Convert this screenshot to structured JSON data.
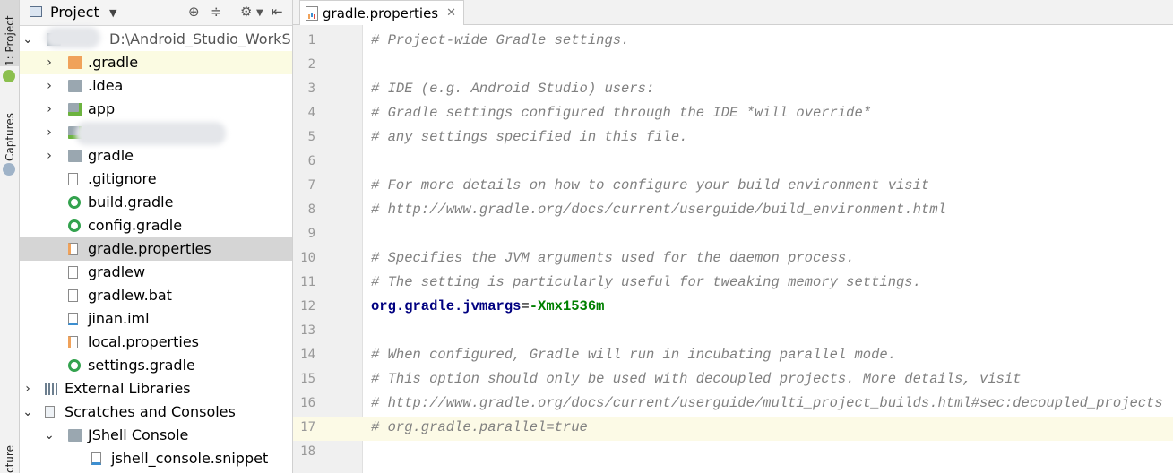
{
  "left_strip": {
    "project_tab": "1: Project",
    "captures_tab": "Captures",
    "structure_tab": "cture"
  },
  "project_panel": {
    "title": "Project",
    "root_path": "D:\\Android_Studio_WorkSp",
    "items": [
      {
        "label": ".gradle",
        "type": "folder-orange",
        "depth": 1,
        "arrow": "›"
      },
      {
        "label": ".idea",
        "type": "folder",
        "depth": 1,
        "arrow": "›"
      },
      {
        "label": "app",
        "type": "folder-module",
        "depth": 1,
        "arrow": "›"
      },
      {
        "label": "",
        "type": "folder-module",
        "depth": 1,
        "arrow": "›"
      },
      {
        "label": "gradle",
        "type": "folder",
        "depth": 1,
        "arrow": "›"
      },
      {
        "label": ".gitignore",
        "type": "file",
        "depth": 1,
        "arrow": ""
      },
      {
        "label": "build.gradle",
        "type": "gradle",
        "depth": 1,
        "arrow": ""
      },
      {
        "label": "config.gradle",
        "type": "gradle",
        "depth": 1,
        "arrow": ""
      },
      {
        "label": "gradle.properties",
        "type": "properties",
        "depth": 1,
        "arrow": ""
      },
      {
        "label": "gradlew",
        "type": "file",
        "depth": 1,
        "arrow": ""
      },
      {
        "label": "gradlew.bat",
        "type": "file",
        "depth": 1,
        "arrow": ""
      },
      {
        "label": "jinan.iml",
        "type": "iml",
        "depth": 1,
        "arrow": ""
      },
      {
        "label": "local.properties",
        "type": "properties",
        "depth": 1,
        "arrow": ""
      },
      {
        "label": "settings.gradle",
        "type": "gradle",
        "depth": 1,
        "arrow": ""
      },
      {
        "label": "External Libraries",
        "type": "libs",
        "depth": 0,
        "arrow": "›"
      },
      {
        "label": "Scratches and Consoles",
        "type": "scratch",
        "depth": 0,
        "arrow": "⌄"
      },
      {
        "label": "JShell Console",
        "type": "folder",
        "depth": 1,
        "arrow": "⌄"
      },
      {
        "label": "jshell_console.snippet",
        "type": "snippet",
        "depth": 2,
        "arrow": ""
      }
    ]
  },
  "editor": {
    "tab_label": "gradle.properties",
    "current_line": 17,
    "lines": [
      {
        "n": "1",
        "kind": "comment",
        "text": "# Project-wide Gradle settings."
      },
      {
        "n": "2",
        "kind": "blank",
        "text": ""
      },
      {
        "n": "3",
        "kind": "comment",
        "text": "# IDE (e.g. Android Studio) users:"
      },
      {
        "n": "4",
        "kind": "comment",
        "text": "# Gradle settings configured through the IDE *will override*"
      },
      {
        "n": "5",
        "kind": "comment",
        "text": "# any settings specified in this file."
      },
      {
        "n": "6",
        "kind": "blank",
        "text": ""
      },
      {
        "n": "7",
        "kind": "comment",
        "text": "# For more details on how to configure your build environment visit"
      },
      {
        "n": "8",
        "kind": "comment",
        "text": "# http://www.gradle.org/docs/current/userguide/build_environment.html"
      },
      {
        "n": "9",
        "kind": "blank",
        "text": ""
      },
      {
        "n": "10",
        "kind": "comment",
        "text": "# Specifies the JVM arguments used for the daemon process."
      },
      {
        "n": "11",
        "kind": "comment",
        "text": "# The setting is particularly useful for tweaking memory settings."
      },
      {
        "n": "12",
        "kind": "property",
        "key": "org.gradle.jvmargs",
        "eq": "=",
        "value": "-Xmx1536m"
      },
      {
        "n": "13",
        "kind": "blank",
        "text": ""
      },
      {
        "n": "14",
        "kind": "comment",
        "text": "# When configured, Gradle will run in incubating parallel mode."
      },
      {
        "n": "15",
        "kind": "comment",
        "text": "# This option should only be used with decoupled projects. More details, visit"
      },
      {
        "n": "16",
        "kind": "comment",
        "text": "# http://www.gradle.org/docs/current/userguide/multi_project_builds.html#sec:decoupled_projects"
      },
      {
        "n": "17",
        "kind": "comment",
        "text": "# org.gradle.parallel=true"
      },
      {
        "n": "18",
        "kind": "blank",
        "text": ""
      }
    ]
  }
}
